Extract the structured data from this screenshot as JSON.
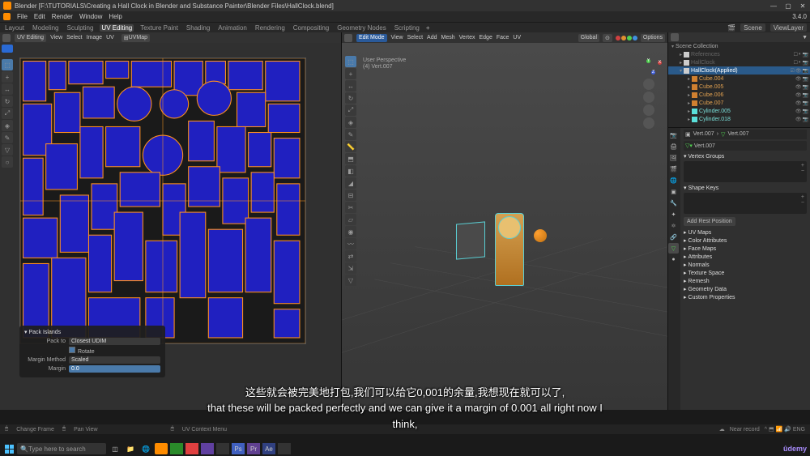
{
  "titlebar": {
    "title": "Blender [F:\\TUTORIALS\\Creating a Hall Clock in Blender and Substance Painter\\Blender Files\\HallClock.blend]"
  },
  "menubar": {
    "items": [
      "File",
      "Edit",
      "Render",
      "Window",
      "Help"
    ],
    "version": "3.4.0"
  },
  "workspaces": {
    "items": [
      "Layout",
      "Modeling",
      "Sculpting",
      "UV Editing",
      "Texture Paint",
      "Shading",
      "Animation",
      "Rendering",
      "Compositing",
      "Geometry Nodes",
      "Scripting"
    ],
    "active": "UV Editing",
    "scene": "Scene",
    "layer": "ViewLayer"
  },
  "uv_editor": {
    "header": {
      "mode": "UV Editing",
      "menus": [
        "View",
        "Select",
        "Image",
        "UV"
      ],
      "map": "UVMap"
    }
  },
  "viewport3d": {
    "header": {
      "mode": "Edit Mode",
      "menus": [
        "View",
        "Select",
        "Add",
        "Mesh",
        "Vertex",
        "Edge",
        "Face",
        "UV"
      ],
      "orientation": "Global",
      "options": "Options"
    },
    "overlay": {
      "perspective": "User Perspective",
      "object": "(4) Vert.007"
    }
  },
  "outliner": {
    "collection": "Scene Collection",
    "items": [
      {
        "name": "References",
        "indent": 1,
        "disabled": true
      },
      {
        "name": "HallClock",
        "indent": 1,
        "disabled": true
      },
      {
        "name": "HallClock(Applied)",
        "indent": 1,
        "active": true,
        "type": "collection"
      },
      {
        "name": "Cube.004",
        "indent": 2,
        "color": "orange"
      },
      {
        "name": "Cube.005",
        "indent": 2,
        "color": "orange"
      },
      {
        "name": "Cube.006",
        "indent": 2,
        "color": "orange"
      },
      {
        "name": "Cube.007",
        "indent": 2,
        "color": "orange"
      },
      {
        "name": "Cylinder.005",
        "indent": 2,
        "color": "cyan"
      },
      {
        "name": "Cylinder.018",
        "indent": 2,
        "color": "cyan"
      }
    ]
  },
  "properties": {
    "breadcrumb": [
      "Vert.007",
      "Vert.007"
    ],
    "object": "Vert.007",
    "sections": [
      "Vertex Groups",
      "Shape Keys"
    ],
    "add_rest": "Add Rest Position",
    "collapsed": [
      "UV Maps",
      "Color Attributes",
      "Face Maps",
      "Attributes",
      "Normals",
      "Texture Space",
      "Remesh",
      "Geometry Data",
      "Custom Properties"
    ]
  },
  "pack_panel": {
    "title": "Pack Islands",
    "pack_to": "Closest UDIM",
    "rotate": "Rotate",
    "margin_method": "Scaled",
    "margin_value": "0.0"
  },
  "statusbar": {
    "left": [
      "Change Frame",
      "Pan View"
    ],
    "center": "UV Context Menu",
    "right": "Near record"
  },
  "subtitle": {
    "cn": "这些就会被完美地打包,我们可以给它0,001的余量,我想现在就可以了,",
    "en": "that these will be packed perfectly and we can give it a margin of 0.001 all right now I think,"
  },
  "taskbar": {
    "search": "Type here to search",
    "lang": "ENG",
    "brand": "ûdemy"
  }
}
